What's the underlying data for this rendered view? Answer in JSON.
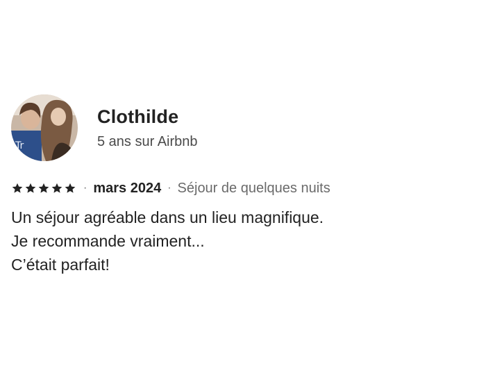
{
  "review": {
    "reviewer": {
      "name": "Clothilde",
      "tenure": "5 ans sur Airbnb",
      "avatar_icon": "profile-photo"
    },
    "rating": {
      "stars": 5,
      "max": 5,
      "star_icon": "star-icon",
      "star_color": "#222222"
    },
    "separator": "·",
    "date": "mars 2024",
    "stay_type": "Séjour de quelques nuits",
    "body_lines": [
      "Un séjour agréable dans un lieu magnifique.",
      "Je recommande vraiment...",
      "C’était parfait!"
    ]
  }
}
